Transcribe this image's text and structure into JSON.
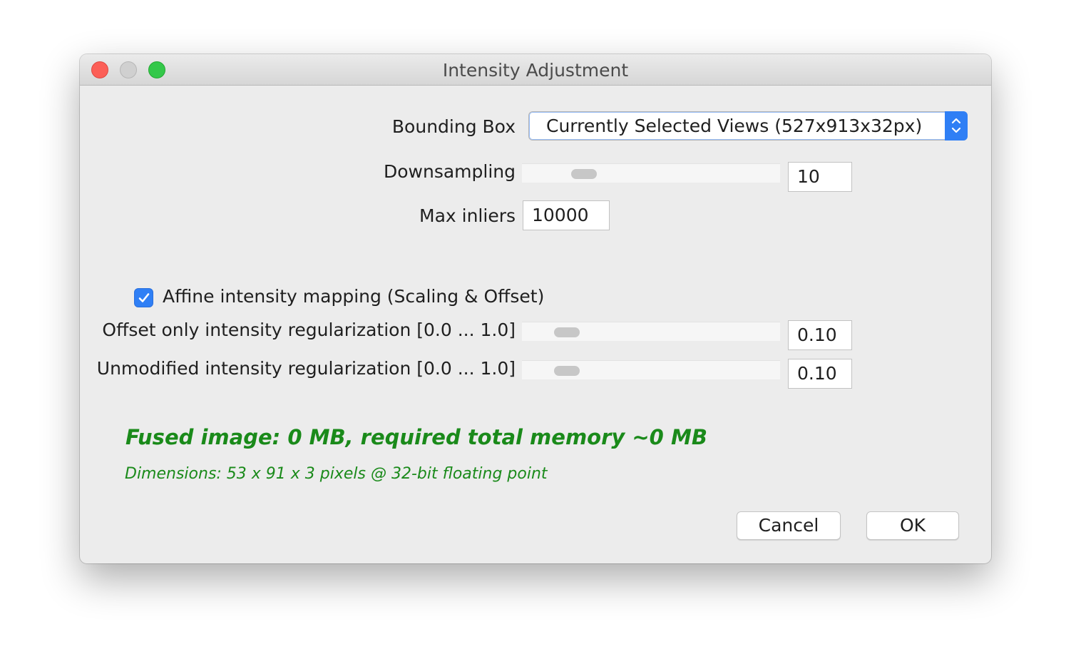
{
  "window": {
    "title": "Intensity Adjustment"
  },
  "bounding_box": {
    "label": "Bounding Box",
    "selected": "Currently Selected Views (527x913x32px)"
  },
  "downsampling": {
    "label": "Downsampling",
    "value": "10",
    "slider_fraction": 0.18
  },
  "max_inliers": {
    "label": "Max inliers",
    "value": "10000"
  },
  "affine_mapping": {
    "label": "Affine intensity mapping (Scaling & Offset)",
    "checked": true
  },
  "offset_regularization": {
    "label": "Offset only intensity regularization [0.0 ... 1.0]",
    "value": "0.10",
    "slider_fraction": 0.1
  },
  "unmodified_regularization": {
    "label": "Unmodified intensity regularization [0.0 ... 1.0]",
    "value": "0.10",
    "slider_fraction": 0.1
  },
  "status": {
    "memory": "Fused image: 0 MB, required total memory ~0 MB",
    "dimensions": "Dimensions: 53 x 91 x 3 pixels @ 32-bit floating point",
    "color": "#1a8a1a"
  },
  "buttons": {
    "cancel": "Cancel",
    "ok": "OK"
  },
  "colors": {
    "accent": "#2f7ff5",
    "close": "#fc5f57",
    "maximize": "#34c84a"
  }
}
